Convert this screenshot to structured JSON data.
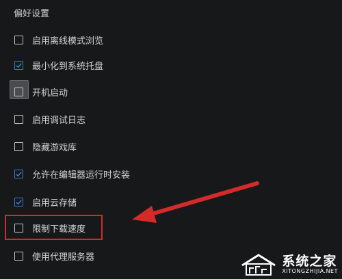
{
  "section_title": "偏好设置",
  "options": [
    {
      "label": "启用离线模式浏览",
      "checked": false
    },
    {
      "label": "最小化到系统托盘",
      "checked": true
    },
    {
      "label": "开机启动",
      "checked": false
    },
    {
      "label": "启用调试日志",
      "checked": false
    },
    {
      "label": "隐藏游戏库",
      "checked": false
    },
    {
      "label": "允许在编辑器运行时安装",
      "checked": true
    },
    {
      "label": "启用云存储",
      "checked": true
    },
    {
      "label": "限制下载速度",
      "checked": false
    },
    {
      "label": "使用代理服务器",
      "checked": false
    }
  ],
  "focused_option": "开机启动",
  "highlighted_option": "限制下载速度",
  "watermark": {
    "cn": "系统之家",
    "en": "XITONGZHIJIA.NET"
  },
  "colors": {
    "background": "#17181a",
    "check_accent": "#3b7fd0",
    "annotation_red": "#d42a2a"
  }
}
